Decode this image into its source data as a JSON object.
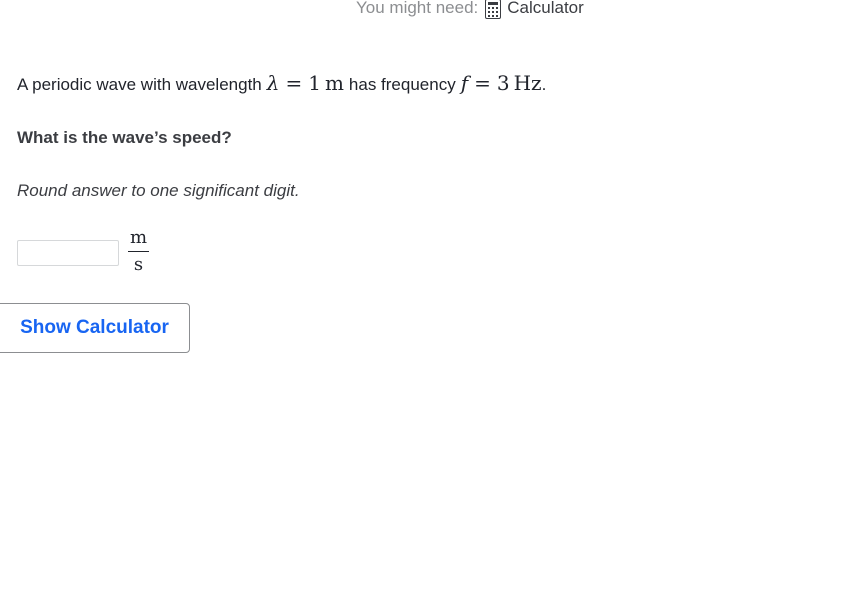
{
  "hint": {
    "label": "You might need:",
    "tool": "Calculator",
    "icon": "calculator-icon"
  },
  "problem": {
    "intro": "A periodic wave with wavelength",
    "wavelength_symbol": "λ",
    "equals": "=",
    "wavelength_value": "1",
    "wavelength_unit": "m",
    "mid": "has frequency",
    "frequency_symbol": "f",
    "frequency_value": "3",
    "frequency_unit": "Hz",
    "end": "."
  },
  "question": "What is the wave’s speed?",
  "instruction": "Round answer to one significant digit.",
  "answer": {
    "value": "",
    "unit_numerator": "m",
    "unit_denominator": "s"
  },
  "show_calculator_label": "Show Calculator"
}
